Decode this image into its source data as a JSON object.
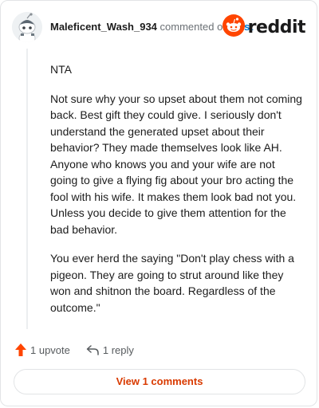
{
  "comment": {
    "username": "Maleficent_Wash_934",
    "commented_on": "commented on",
    "post_link": "post",
    "paragraphs": [
      "NTA",
      "Not sure why your so upset about them not coming back. Best gift they could give. I seriously don't understand the generated upset about their behavior? They made themselves look like AH. Anyone who knows you and your wife are not going to give a flying fig about your bro acting the fool with his wife. It makes them look bad not you. Unless you decide to give them attention for the bad behavior.",
      "You ever herd the saying \"Don't play chess with a pigeon. They are going to strut around like they won and shitnon the board. Regardless of the outcome.\""
    ]
  },
  "brand": {
    "wordmark": "reddit",
    "color": "#ff4500"
  },
  "actions": {
    "upvote_label": "1 upvote",
    "reply_label": "1 reply",
    "upvote_color": "#ff4500"
  },
  "view_comments_label": "View 1 comments",
  "icons": [
    "snoo-avatar-icon",
    "reddit-logo-icon",
    "upvote-arrow-icon",
    "reply-arrow-icon"
  ]
}
